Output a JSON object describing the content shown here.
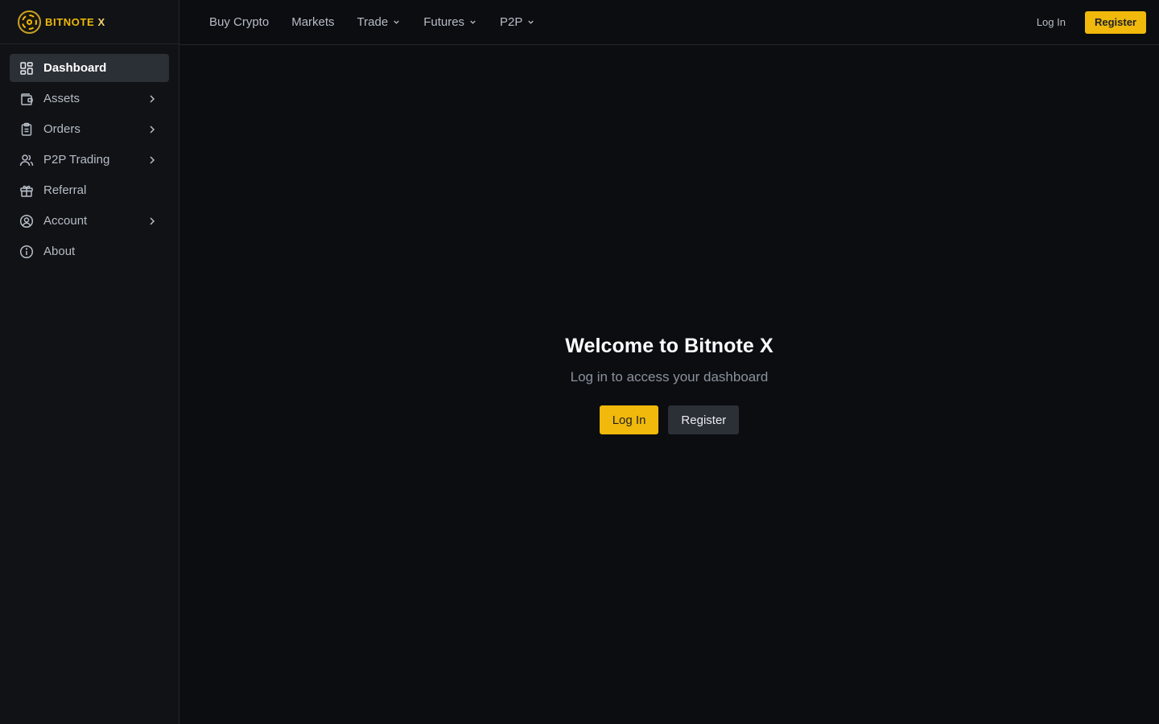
{
  "brand": {
    "name_a": "BITNOTE",
    "name_b": " X",
    "icon": "coin-logo-icon",
    "accent": "#f0b90b"
  },
  "sidebar": {
    "items": [
      {
        "label": "Dashboard",
        "icon": "dashboard-icon",
        "active": true,
        "has_chevron": false
      },
      {
        "label": "Assets",
        "icon": "wallet-icon",
        "active": false,
        "has_chevron": true
      },
      {
        "label": "Orders",
        "icon": "clipboard-icon",
        "active": false,
        "has_chevron": true
      },
      {
        "label": "P2P Trading",
        "icon": "users-icon",
        "active": false,
        "has_chevron": true
      },
      {
        "label": "Referral",
        "icon": "gift-icon",
        "active": false,
        "has_chevron": false
      },
      {
        "label": "Account",
        "icon": "user-circle-icon",
        "active": false,
        "has_chevron": true
      },
      {
        "label": "About",
        "icon": "info-icon",
        "active": false,
        "has_chevron": false
      }
    ]
  },
  "topnav": {
    "items": [
      {
        "label": "Buy Crypto",
        "dropdown": false
      },
      {
        "label": "Markets",
        "dropdown": false
      },
      {
        "label": "Trade",
        "dropdown": true
      },
      {
        "label": "Futures",
        "dropdown": true
      },
      {
        "label": "P2P",
        "dropdown": true
      }
    ],
    "login_label": "Log In",
    "register_label": "Register"
  },
  "main": {
    "title": "Welcome to Bitnote X",
    "subtitle": "Log in to access your dashboard",
    "login_label": "Log In",
    "register_label": "Register"
  }
}
